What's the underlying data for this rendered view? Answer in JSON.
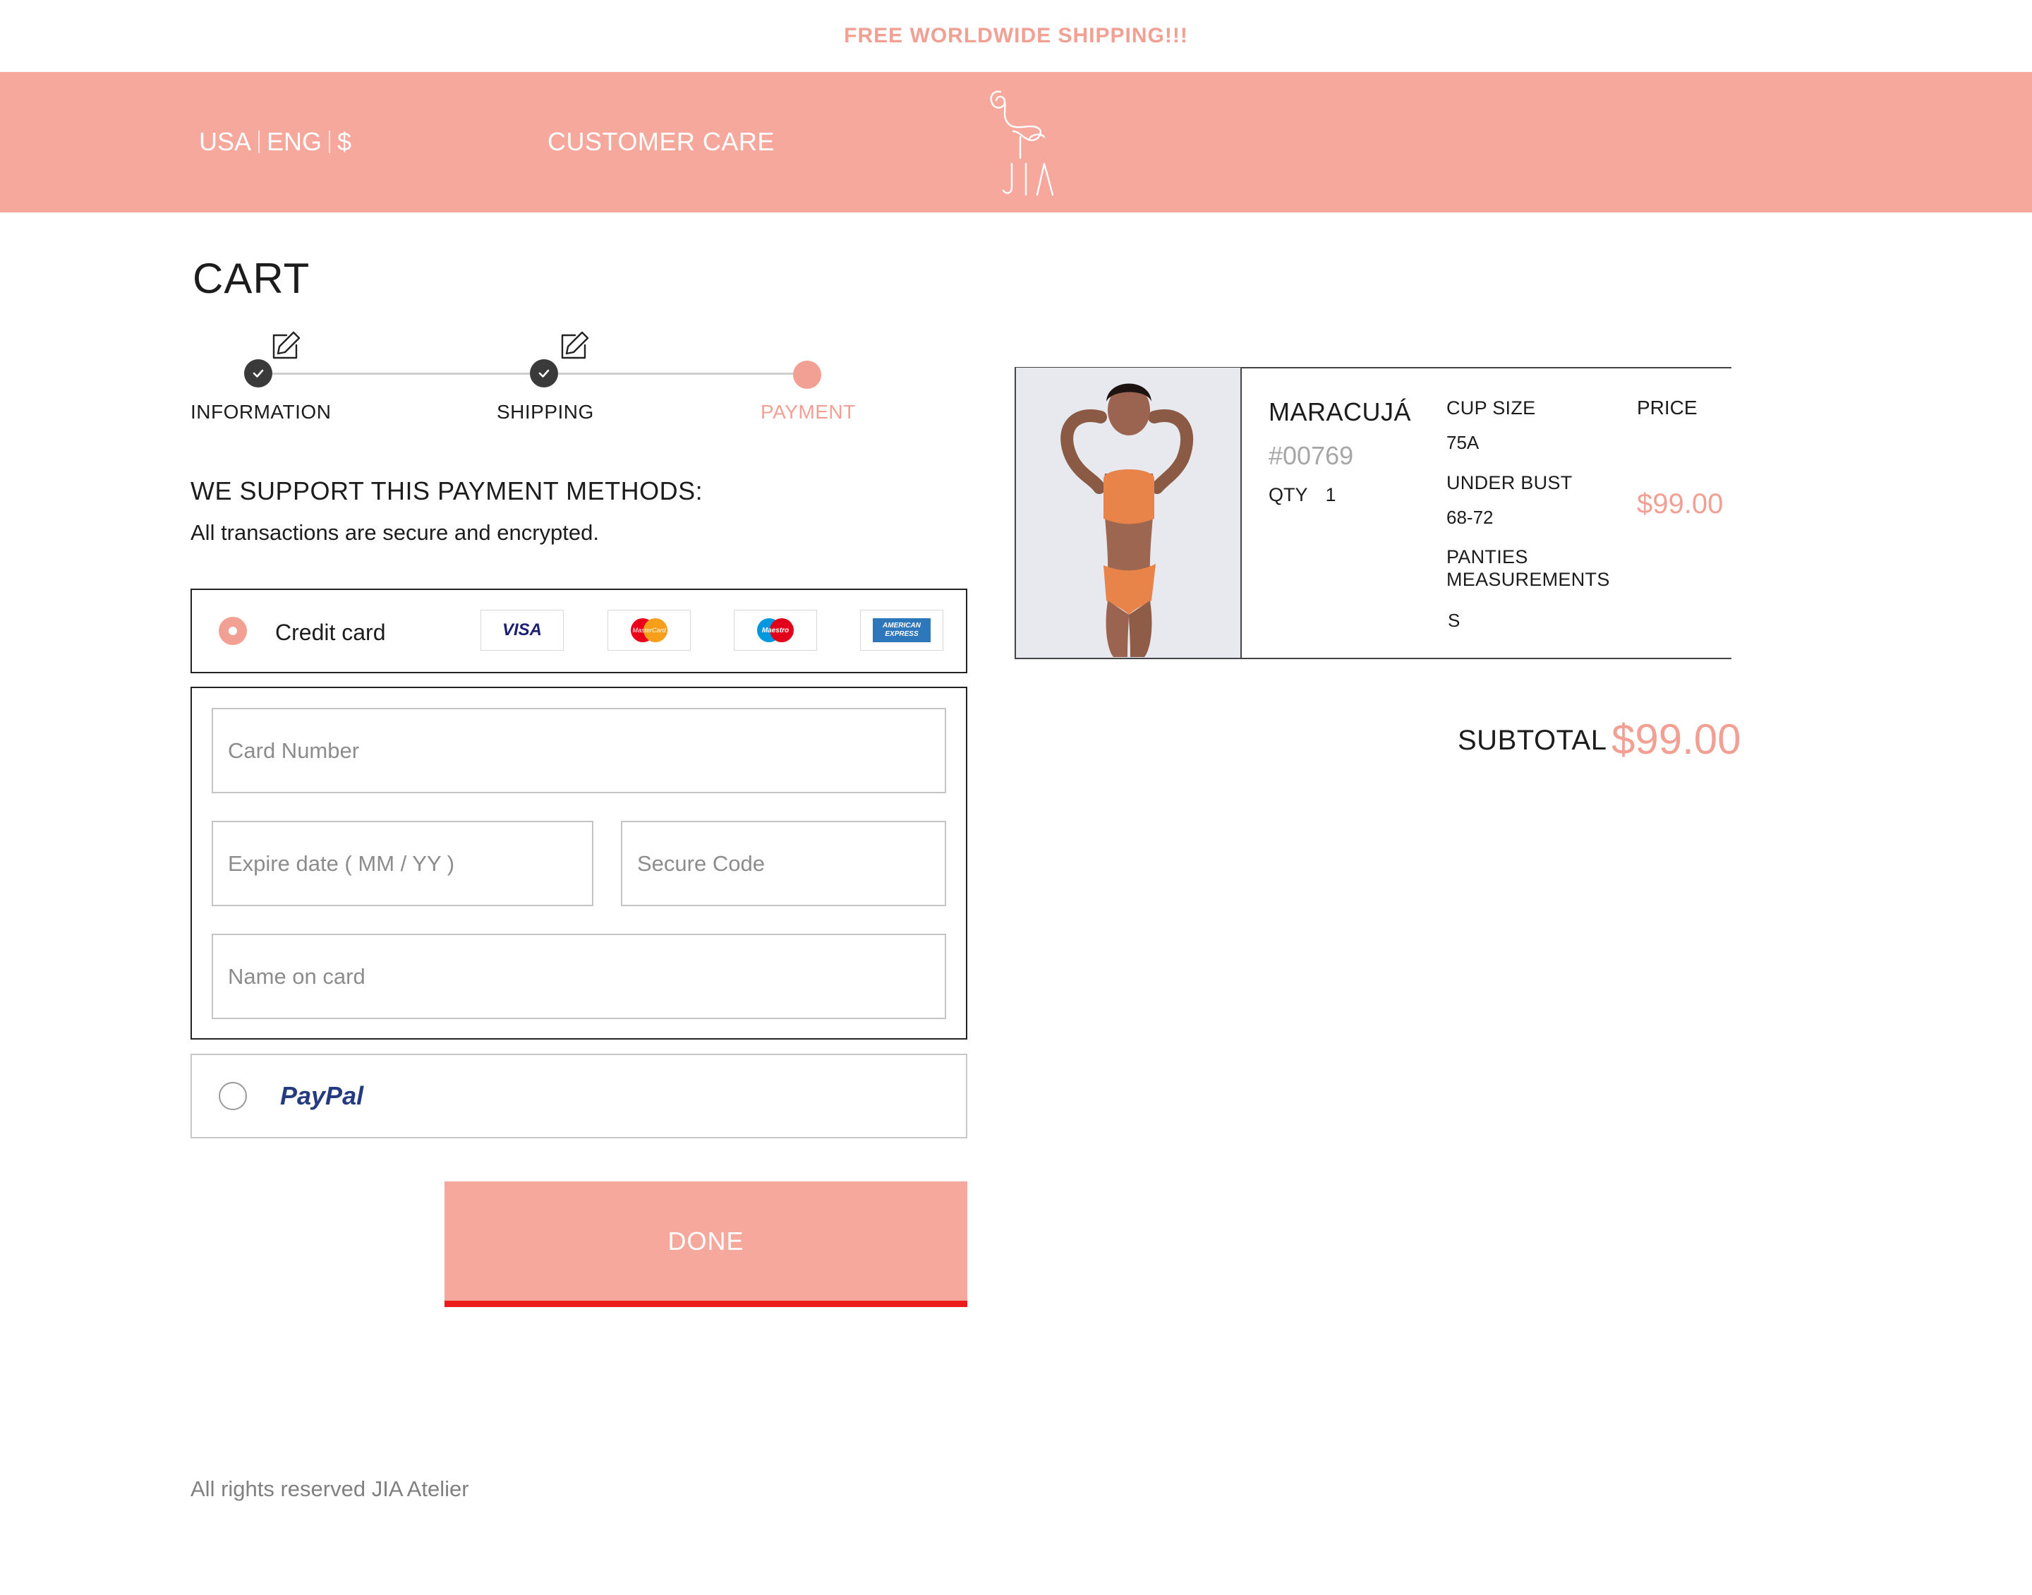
{
  "promo": {
    "text": "FREE WORLDWIDE SHIPPING!!!"
  },
  "header": {
    "country": "USA",
    "language": "ENG",
    "currency": "$",
    "customer_care": "CUSTOMER CARE",
    "logo_text": "JIA"
  },
  "cart": {
    "title": "CART",
    "steps": [
      {
        "label": "INFORMATION",
        "state": "completed"
      },
      {
        "label": "SHIPPING",
        "state": "completed"
      },
      {
        "label": "PAYMENT",
        "state": "active"
      }
    ]
  },
  "payment": {
    "heading": "WE SUPPORT THIS PAYMENT METHODS:",
    "subtext": "All transactions are secure and encrypted.",
    "credit_card": {
      "label": "Credit card",
      "selected": true,
      "logos": [
        "VISA",
        "MasterCard",
        "Maestro",
        "AMERICAN EXPRESS"
      ]
    },
    "fields": {
      "card_number": "Card Number",
      "expire_date": "Expire date ( MM / YY )",
      "secure_code": "Secure Code",
      "name_on_card": "Name on card"
    },
    "paypal": {
      "label": "PayPal",
      "selected": false
    },
    "done_button": "DONE"
  },
  "order": {
    "product_name": "MARACUJÁ",
    "sku": "#00769",
    "qty_label": "QTY",
    "qty_value": "1",
    "cup_size_label": "CUP SIZE",
    "cup_size_value": "75A",
    "under_bust_label": "UNDER BUST",
    "under_bust_value": "68-72",
    "panties_label_1": "PANTIES",
    "panties_label_2": "MEASUREMENTS",
    "panties_value": "S",
    "price_label": "PRICE",
    "price_value": "$99.00",
    "subtotal_label": "SUBTOTAL",
    "subtotal_value": "$99.00"
  },
  "footer": {
    "text": "All rights reserved JIA Atelier"
  },
  "colors": {
    "accent": "#f6a89d",
    "accent_text": "#f2a094",
    "done_underline": "#ec1c1c"
  }
}
